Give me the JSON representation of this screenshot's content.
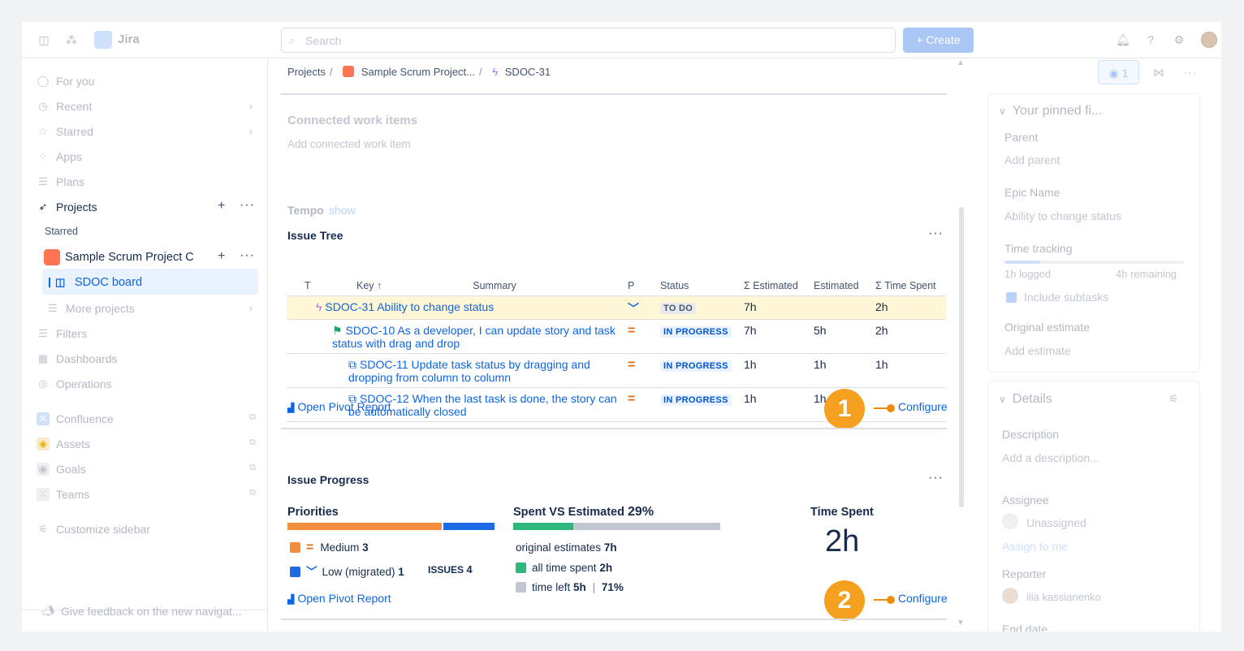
{
  "topbar": {
    "app_name": "Jira",
    "search_placeholder": "Search",
    "create_label": "+ Create"
  },
  "sidebar": {
    "items": [
      {
        "label": "For you",
        "icon": "user-circle-icon"
      },
      {
        "label": "Recent",
        "icon": "clock-icon"
      },
      {
        "label": "Starred",
        "icon": "star-icon"
      },
      {
        "label": "Apps",
        "icon": "apps-icon"
      },
      {
        "label": "Plans",
        "icon": "plans-icon"
      },
      {
        "label": "Projects",
        "icon": "rocket-icon"
      }
    ],
    "starred_heading": "Starred",
    "project_name": "Sample Scrum Project C",
    "board_name": "SDOC board",
    "more_projects": "More projects",
    "lower_items": [
      {
        "label": "Filters",
        "icon": "filter-icon"
      },
      {
        "label": "Dashboards",
        "icon": "dashboard-icon"
      },
      {
        "label": "Operations",
        "icon": "operations-icon"
      }
    ],
    "apps": [
      {
        "label": "Confluence",
        "icon": "confluence-icon"
      },
      {
        "label": "Assets",
        "icon": "assets-icon"
      },
      {
        "label": "Goals",
        "icon": "goals-icon"
      },
      {
        "label": "Teams",
        "icon": "teams-icon"
      }
    ],
    "customize": "Customize sidebar",
    "feedback": "Give feedback on the new navigat..."
  },
  "breadcrumb": {
    "projects": "Projects",
    "project": "Sample Scrum Project...",
    "issue": "SDOC-31"
  },
  "connected": {
    "title": "Connected work items",
    "add": "Add connected work item"
  },
  "tempo": {
    "label": "Tempo",
    "show": "show"
  },
  "issue_tree": {
    "title": "Issue Tree",
    "columns": {
      "t": "T",
      "key": "Key ↑",
      "summary": "Summary",
      "p": "P",
      "status": "Status",
      "sum_est": "Σ Estimated",
      "est": "Estimated",
      "sum_spent": "Σ Time Spent"
    },
    "rows": [
      {
        "text": "SDOC-31 Ability to change status",
        "status": "TO DO",
        "sum_est": "7h",
        "est": "",
        "spent": "2h"
      },
      {
        "text": "SDOC-10 As a developer, I can update story and task status with drag and drop",
        "status": "IN PROGRESS",
        "sum_est": "7h",
        "est": "5h",
        "spent": "2h"
      },
      {
        "text": "SDOC-11 Update task status by dragging and dropping from column to column",
        "status": "IN PROGRESS",
        "sum_est": "1h",
        "est": "1h",
        "spent": "1h"
      },
      {
        "text": "SDOC-12 When the last task is done, the story can be automatically closed",
        "status": "IN PROGRESS",
        "sum_est": "1h",
        "est": "1h",
        "spent": ""
      }
    ],
    "pivot": "Open Pivot Report",
    "configure": "Configure",
    "callout": "1"
  },
  "issue_progress": {
    "title": "Issue Progress",
    "priorities_label": "Priorities",
    "priority_share": [
      0.75,
      0.25
    ],
    "medium_label": "Medium",
    "medium_count": "3",
    "low_label": "Low (migrated)",
    "low_count": "1",
    "issues_label": "ISSUES",
    "issues_count": "4",
    "spent_label": "Spent VS Estimated",
    "spent_pct": "29%",
    "spent_fraction": 0.29,
    "orig_label": "original estimates",
    "orig_val": "7h",
    "all_label": "all time spent",
    "all_val": "2h",
    "left_label": "time left",
    "left_val": "5h",
    "left_pct": "71%",
    "time_spent_label": "Time Spent",
    "time_spent_val": "2h",
    "pivot": "Open Pivot Report",
    "configure": "Configure",
    "callout": "2"
  },
  "right_panel": {
    "watch_count": "1",
    "pinned_title": "Your pinned fi...",
    "parent_label": "Parent",
    "parent_add": "Add parent",
    "epic_label": "Epic Name",
    "epic_value": "Ability to change status",
    "tracking_label": "Time tracking",
    "logged": "1h logged",
    "remaining": "4h remaining",
    "subtasks": "Include subtasks",
    "orig_label": "Original estimate",
    "orig_add": "Add estimate",
    "details_title": "Details",
    "desc_label": "Description",
    "desc_add": "Add a description...",
    "assignee_label": "Assignee",
    "assignee_value": "Unassigned",
    "assign_me": "Assign to me",
    "reporter_label": "Reporter",
    "reporter_value": "ilia kassianenko",
    "end_date_label": "End date"
  },
  "colors": {
    "medium": "#f18d3c",
    "low": "#1d6ae5",
    "spent": "#2eb67d",
    "remaining": "#c1c7d0",
    "callout": "#f5a01e"
  }
}
